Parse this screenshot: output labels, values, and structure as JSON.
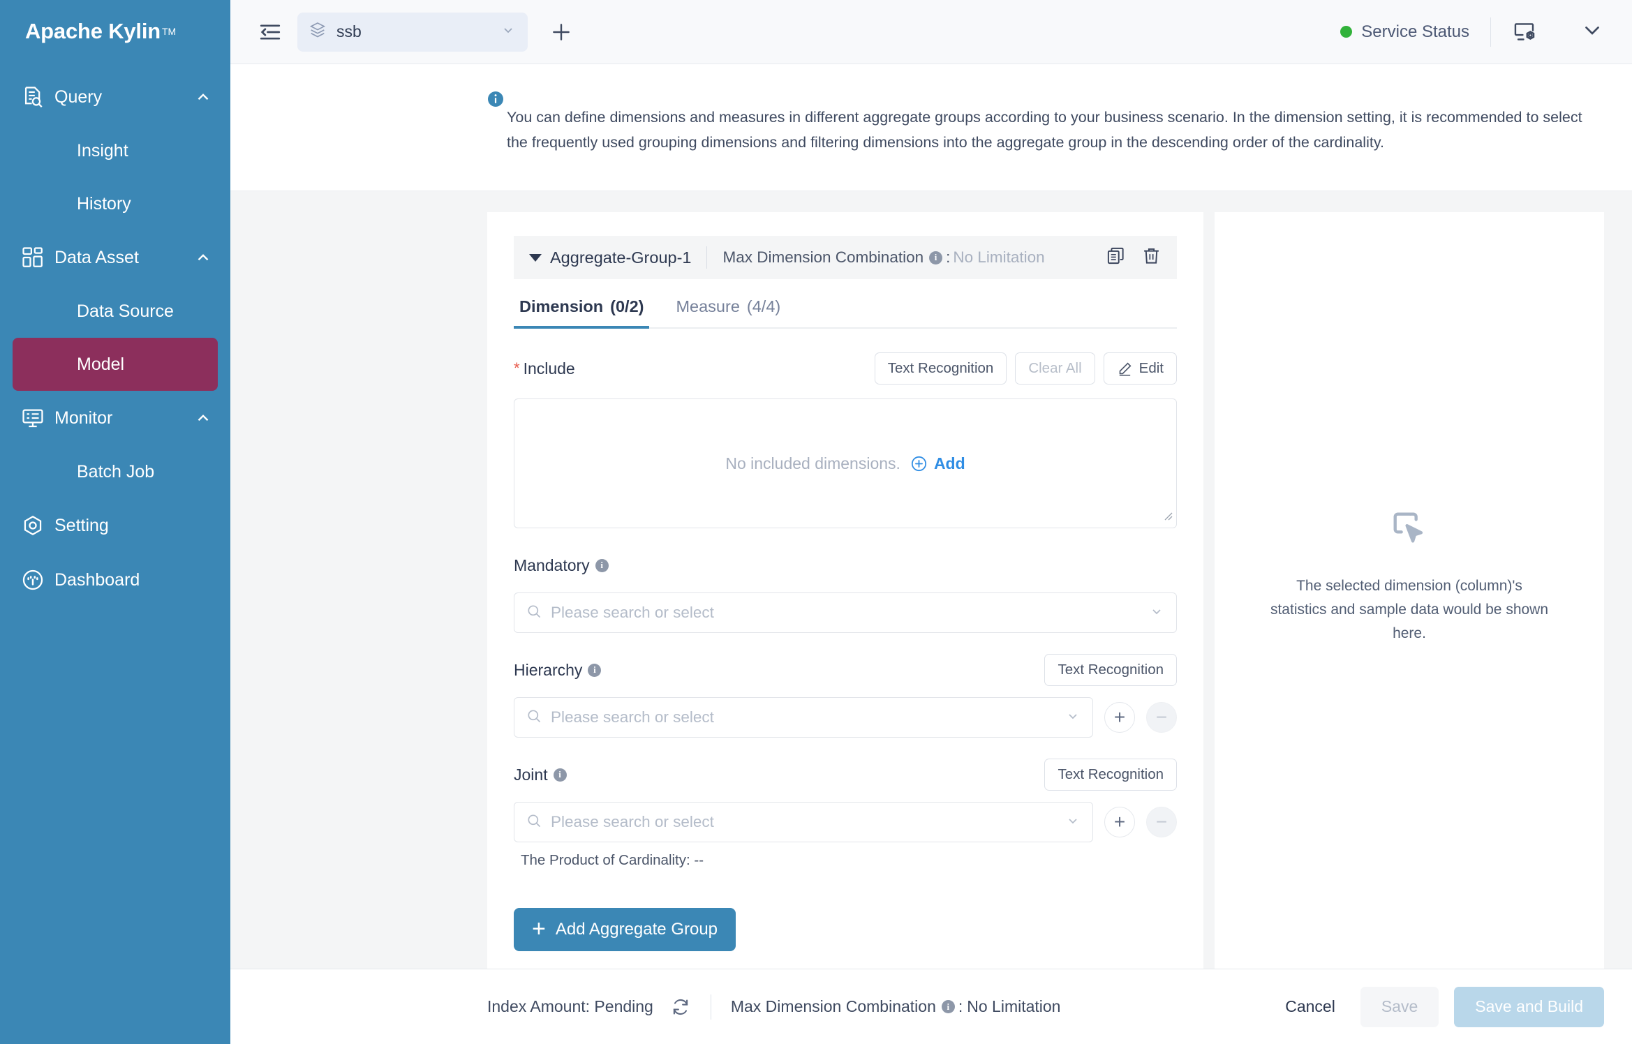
{
  "brand": {
    "name": "Apache Kylin",
    "tm": "TM"
  },
  "sidebar": {
    "groups": [
      {
        "id": "query",
        "label": "Query",
        "icon": "query-icon",
        "expanded": true,
        "items": [
          {
            "label": "Insight",
            "active": false
          },
          {
            "label": "History",
            "active": false
          }
        ]
      },
      {
        "id": "data-asset",
        "label": "Data Asset",
        "icon": "data-asset-icon",
        "expanded": true,
        "items": [
          {
            "label": "Data Source",
            "active": false
          },
          {
            "label": "Model",
            "active": true
          }
        ]
      },
      {
        "id": "monitor",
        "label": "Monitor",
        "icon": "monitor-icon",
        "expanded": true,
        "items": [
          {
            "label": "Batch Job",
            "active": false
          }
        ]
      }
    ],
    "links": [
      {
        "id": "setting",
        "label": "Setting",
        "icon": "setting-icon"
      },
      {
        "id": "dashboard",
        "label": "Dashboard",
        "icon": "dashboard-icon"
      }
    ]
  },
  "topbar": {
    "collapse_icon": "collapse-sidebar-icon",
    "project": "ssb",
    "project_icon": "layers-icon",
    "add_project_icon": "plus-icon",
    "service_status": "Service Status",
    "service_status_color": "#31b23a",
    "admin_icon": "system-admin-icon",
    "user_menu_icon": "chevron-down-icon"
  },
  "banner": {
    "icon": "info-icon",
    "text": "You can define dimensions and measures in different aggregate groups according to your business scenario. In the dimension setting, it is recommended to select the frequently used grouping dimensions and filtering dimensions into the aggregate group in the descending order of the cardinality."
  },
  "aggregate_group": {
    "name": "Aggregate-Group-1",
    "max_dimension_combination_label": "Max Dimension Combination",
    "max_dimension_combination_separator": ":",
    "max_dimension_combination_value": "No Limitation",
    "copy_icon": "copy-icon",
    "delete_icon": "trash-icon",
    "tabs": [
      {
        "label": "Dimension",
        "count": "(0/2)",
        "active": true
      },
      {
        "label": "Measure",
        "count": "(4/4)",
        "active": false
      }
    ],
    "include": {
      "label": "Include",
      "required": "*",
      "text_recognition": "Text Recognition",
      "clear_all": "Clear All",
      "edit": "Edit",
      "empty_text": "No included dimensions.",
      "add_link": "Add"
    },
    "mandatory": {
      "label": "Mandatory",
      "placeholder": "Please search or select"
    },
    "hierarchy": {
      "label": "Hierarchy",
      "text_recognition": "Text Recognition",
      "placeholder": "Please search or select",
      "add": "+",
      "remove": "−"
    },
    "joint": {
      "label": "Joint",
      "text_recognition": "Text Recognition",
      "placeholder": "Please search or select",
      "add": "+",
      "remove": "−",
      "cardinality": "The Product of Cardinality: --"
    },
    "add_group_button": "Add Aggregate Group"
  },
  "right_panel": {
    "icon": "click-select-icon",
    "text": "The selected dimension (column)'s statistics and sample data would be shown here."
  },
  "footer": {
    "index_amount": "Index Amount: Pending",
    "refresh_icon": "refresh-icon",
    "max_dimension_combination_label": "Max Dimension Combination",
    "max_dimension_combination_separator": ":",
    "max_dimension_combination_value": "No Limitation",
    "cancel": "Cancel",
    "save": "Save",
    "save_and_build": "Save and Build"
  },
  "colors": {
    "sidebar": "#3b87b5",
    "active_nav": "#8c2f5c",
    "primary": "#3b87b5",
    "link": "#2f8de4",
    "status_ok": "#31b23a",
    "required": "#e85a4b"
  }
}
